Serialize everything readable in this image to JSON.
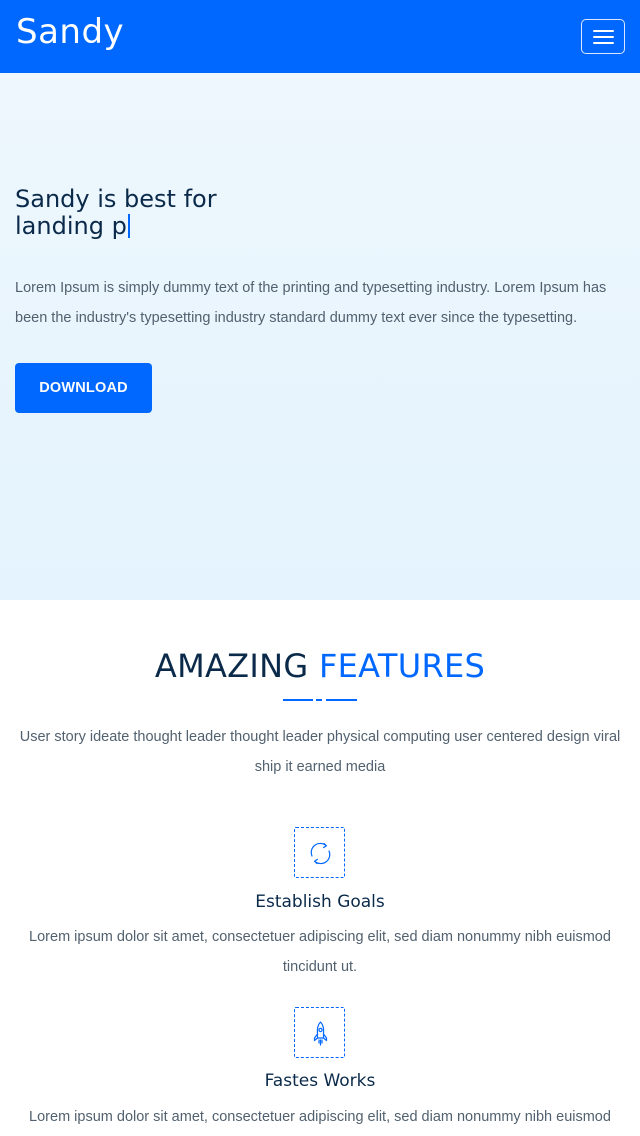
{
  "navbar": {
    "brand": "Sandy",
    "menu_icon": "hamburger-menu-icon"
  },
  "hero": {
    "title_line1": "Sandy is best for",
    "title_line2": "landing p",
    "text": "Lorem Ipsum is simply dummy text of the printing and typesetting industry. Lorem Ipsum has been the industry's typesetting industry standard dummy text ever since the typesetting.",
    "download_label": "DOWNLOAD"
  },
  "features": {
    "heading_part1": "AMAZING",
    "heading_part2": "FEATURES",
    "description": "User story ideate thought leader thought leader physical computing user centered design viral ship it earned media",
    "items": [
      {
        "icon": "refresh-arrows-icon",
        "title": "Establish Goals",
        "text": "Lorem ipsum dolor sit amet, consectetuer adipiscing elit, sed diam nonummy nibh euismod tincidunt ut."
      },
      {
        "icon": "rocket-icon",
        "title": "Fastes Works",
        "text": "Lorem ipsum dolor sit amet, consectetuer adipiscing elit, sed diam nonummy nibh euismod"
      }
    ]
  },
  "colors": {
    "primary": "#0068ff",
    "heading": "#0b2a4a",
    "body_text": "#52616f",
    "hero_background": "#e8f5fd"
  }
}
